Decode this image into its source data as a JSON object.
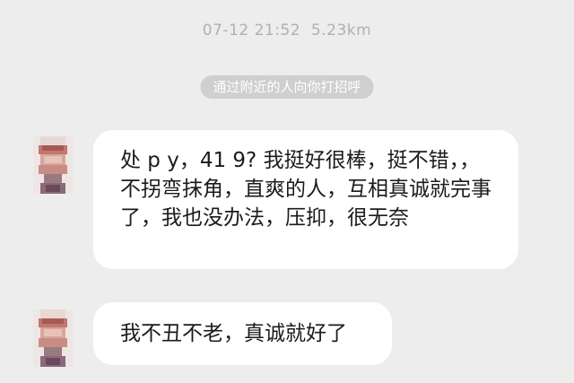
{
  "meta": {
    "date": "07-12",
    "time": "21:52",
    "distance": "5.23km"
  },
  "system_notice": "通过附近的人向你打招呼",
  "messages": [
    {
      "sender": "other",
      "avatar_icon": "pixelated-avatar-icon",
      "text": "处 p y，41 9? 我挺好很棒，挺不错，，不拐弯抹角，直爽的人，互相真诚就完事了，我也没办法，压抑，很无奈"
    },
    {
      "sender": "other",
      "avatar_icon": "pixelated-avatar-icon",
      "text": "我不丑不老，真诚就好了"
    }
  ],
  "colors": {
    "background": "#ededed",
    "bubble": "#ffffff",
    "meta_text": "#b0b0b0",
    "pill": "#cfcfcf",
    "text": "#1b1b1b"
  }
}
